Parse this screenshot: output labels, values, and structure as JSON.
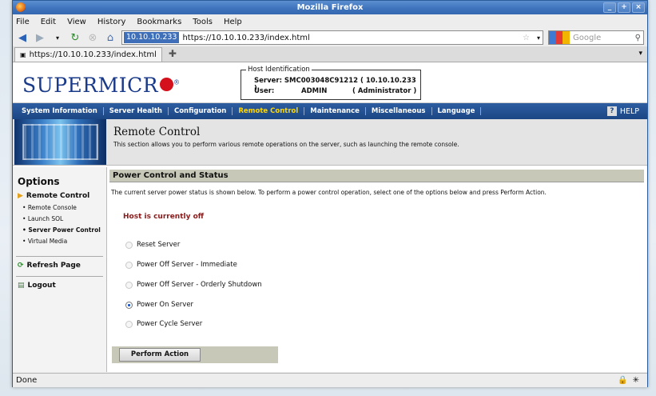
{
  "window": {
    "title": "Mozilla Firefox"
  },
  "menu": [
    "File",
    "Edit",
    "View",
    "History",
    "Bookmarks",
    "Tools",
    "Help"
  ],
  "nav": {
    "site_badge": "10.10.10.233",
    "url": "https://10.10.10.233/index.html",
    "search_placeholder": "Google"
  },
  "tab": {
    "label": "https://10.10.10.233/index.html"
  },
  "header": {
    "logo_text": "SUPERMICR",
    "host_legend": "Host Identification",
    "server_line": "Server: SMC003048C91212 ( 10.10.10.233 )",
    "user_label": "User:",
    "user_name": "ADMIN",
    "user_role": "( Administrator )"
  },
  "topnav": {
    "items": [
      "System Information",
      "Server Health",
      "Configuration",
      "Remote Control",
      "Maintenance",
      "Miscellaneous",
      "Language"
    ],
    "help": "HELP"
  },
  "banner": {
    "title": "Remote Control",
    "desc": "This section allows you to perform various remote operations on the server, such as launching the remote console."
  },
  "sidebar": {
    "heading": "Options",
    "section": "Remote Control",
    "items": [
      "Remote Console",
      "Launch SOL",
      "Server Power Control",
      "Virtual Media"
    ],
    "refresh": "Refresh Page",
    "logout": "Logout"
  },
  "main": {
    "section_title": "Power Control and Status",
    "message": "The current server power status is shown below. To perform a power control operation, select one of the options below and press Perform Action.",
    "status": "Host is currently off",
    "options": [
      "Reset Server",
      "Power Off Server - Immediate",
      "Power Off Server - Orderly Shutdown",
      "Power On Server",
      "Power Cycle Server"
    ],
    "selected_option": "Power On Server",
    "action_button": "Perform Action"
  },
  "statusbar": {
    "text": "Done"
  }
}
